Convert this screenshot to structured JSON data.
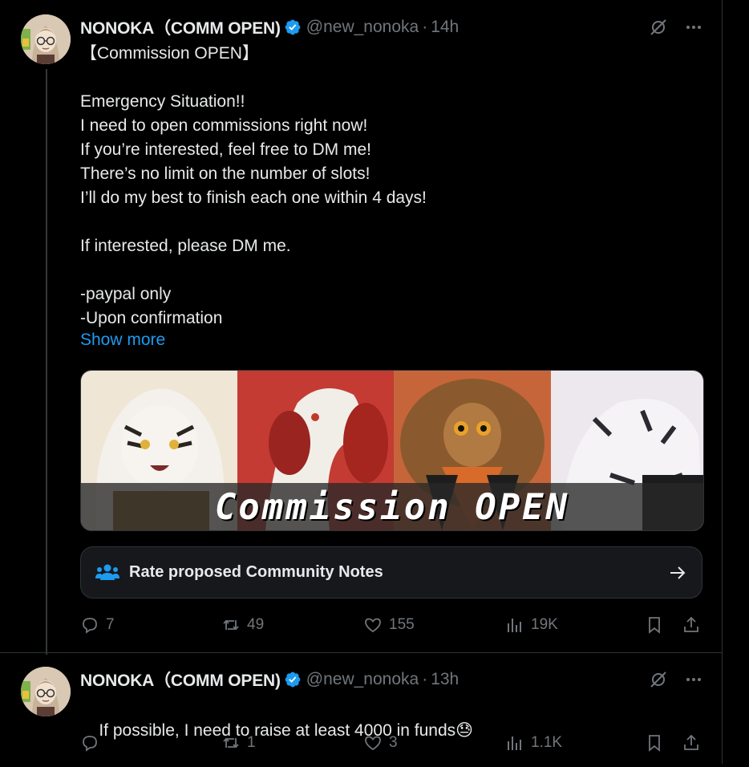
{
  "tweets": [
    {
      "display_name": "NONOKA（COMM OPEN)",
      "handle": "@new_nonoka",
      "separator": "·",
      "time": "14h",
      "body": "【Commission OPEN】\n\nEmergency Situation!!\nI need to open commissions right now!\nIf you’re interested, feel free to DM me!\nThere’s no limit on the number of slots!\nI’ll do my best to finish each one within 4 days!\n\nIf interested, please DM me.\n\n-paypal only\n-Upon confirmation",
      "show_more": "Show more",
      "media_caption": "Commission OPEN",
      "community_notes": "Rate proposed Community Notes",
      "replies": "7",
      "reposts": "49",
      "likes": "155",
      "views": "19K"
    },
    {
      "display_name": "NONOKA（COMM OPEN)",
      "handle": "@new_nonoka",
      "separator": "·",
      "time": "13h",
      "body": "If possible, I need to raise at least 4000 in funds",
      "emoji": "😓",
      "replies": "",
      "reposts": "1",
      "likes": "3",
      "views": "1.1K"
    }
  ],
  "icons": {
    "verified": "verified-badge-icon",
    "grok": "grok-icon",
    "more": "more-icon",
    "reply": "reply-icon",
    "repost": "repost-icon",
    "like": "like-icon",
    "views": "views-icon",
    "bookmark": "bookmark-icon",
    "share": "share-icon",
    "people": "people-icon",
    "arrow": "arrow-right-icon"
  },
  "colors": {
    "background": "#000000",
    "text": "#e7e9ea",
    "secondary": "#71767b",
    "link": "#1d9bf0",
    "verified": "#1d9bf0"
  }
}
